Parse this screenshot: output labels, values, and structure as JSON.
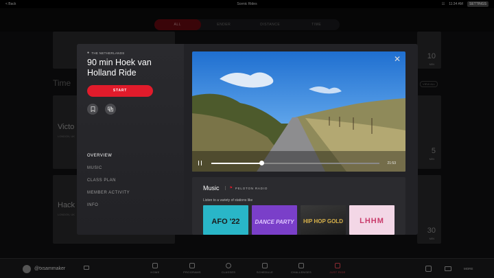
{
  "topbar": {
    "back": "< Back",
    "title": "Scenic Rides",
    "time_text": "11:34 AM",
    "settings_label": "SETTINGS"
  },
  "filters": {
    "tabs": [
      "ALL",
      "ENDER",
      "DISTANCE",
      "TIME"
    ]
  },
  "background": {
    "section_title": "Time",
    "view_all": "VIEW ALL",
    "cards": [
      {
        "title": "Victo",
        "sub": "LONDON, UK",
        "num": "5",
        "unit": "MIN"
      },
      {
        "title": "Hack",
        "sub": "LONDON, UK",
        "num": "30",
        "unit": "MIN"
      },
      {
        "num": "10",
        "unit": "MIN"
      }
    ]
  },
  "modal": {
    "location": "THE NETHERLANDS",
    "title": "90 min Hoek van Holland Ride",
    "start_label": "START",
    "nav": [
      "OVERVIEW",
      "MUSIC",
      "CLASS PLAN",
      "MEMBER ACTIVITY",
      "INFO"
    ],
    "active_nav": "OVERVIEW",
    "video": {
      "time_remaining": "21:53",
      "progress": 0.3
    },
    "music": {
      "heading": "Music",
      "brand": "PELOTON RADIO",
      "description": "Listen to a variety of stations like",
      "stations": [
        {
          "name": "AFO '22",
          "bg": "#29b6c8",
          "fg": "#1a1a1a"
        },
        {
          "name": "DANCE PARTY",
          "bg": "#7a3fc9",
          "fg": "#e0c8ff"
        },
        {
          "name": "HIP HOP GOLD",
          "bg": "#2a2a2a",
          "fg": "#d9b24a"
        },
        {
          "name": "LHHM",
          "bg": "#f3d7e6",
          "fg": "#c93a6a"
        }
      ]
    }
  },
  "bottom_nav": {
    "username": "@txsammaker",
    "items": [
      "HOME",
      "PROGRAMS",
      "CLASSES",
      "SCHEDULE",
      "CHALLENGES",
      "JUST RIDE"
    ],
    "active": "JUST RIDE",
    "more_label": "MORE"
  }
}
